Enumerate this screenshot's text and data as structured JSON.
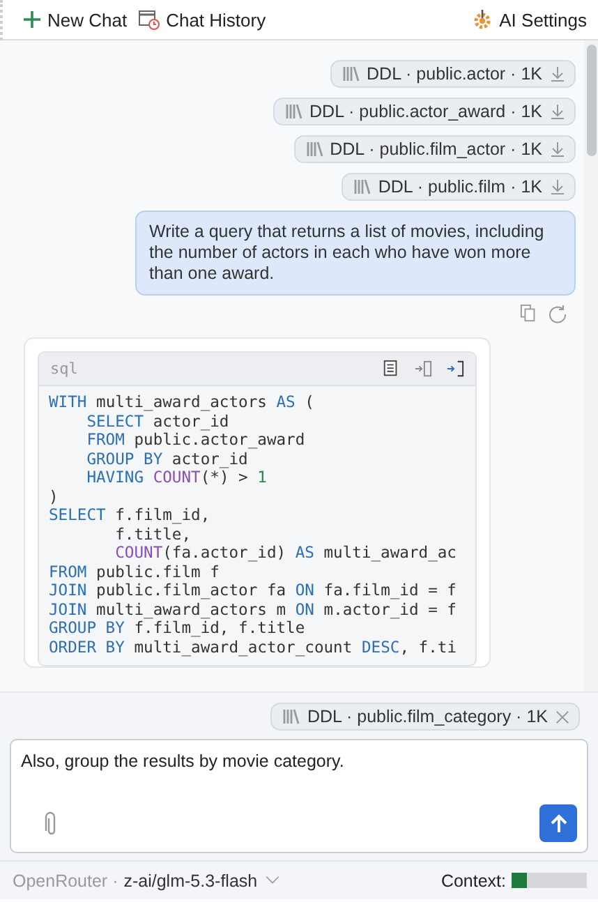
{
  "toolbar": {
    "new_chat": "New Chat",
    "chat_history": "Chat History",
    "ai_settings": "AI Settings"
  },
  "attachments": [
    {
      "label": "DDL · public.actor · 1K"
    },
    {
      "label": "DDL · public.actor_award · 1K"
    },
    {
      "label": "DDL · public.film_actor · 1K"
    },
    {
      "label": "DDL · public.film · 1K"
    }
  ],
  "user_message": "Write a query that returns a list of movies, including the number of actors in each who have won more than one award.",
  "code_block": {
    "language": "sql",
    "lines": [
      [
        {
          "kind": "kw",
          "text": "WITH"
        },
        {
          "kind": "plain",
          "text": " multi_award_actors "
        },
        {
          "kind": "kw",
          "text": "AS"
        },
        {
          "kind": "plain",
          "text": " ("
        }
      ],
      [
        {
          "kind": "kw",
          "text": "    SELECT"
        },
        {
          "kind": "plain",
          "text": " actor_id"
        }
      ],
      [
        {
          "kind": "kw",
          "text": "    FROM"
        },
        {
          "kind": "plain",
          "text": " public.actor_award"
        }
      ],
      [
        {
          "kind": "kw",
          "text": "    GROUP BY"
        },
        {
          "kind": "plain",
          "text": " actor_id"
        }
      ],
      [
        {
          "kind": "kw",
          "text": "    HAVING "
        },
        {
          "kind": "fn",
          "text": "COUNT"
        },
        {
          "kind": "plain",
          "text": "(*) > "
        },
        {
          "kind": "num",
          "text": "1"
        }
      ],
      [
        {
          "kind": "plain",
          "text": ")"
        }
      ],
      [
        {
          "kind": "kw",
          "text": "SELECT"
        },
        {
          "kind": "plain",
          "text": " f.film_id,"
        }
      ],
      [
        {
          "kind": "plain",
          "text": "       f.title,"
        }
      ],
      [
        {
          "kind": "fn",
          "text": "       COUNT"
        },
        {
          "kind": "plain",
          "text": "(fa.actor_id) "
        },
        {
          "kind": "kw",
          "text": "AS"
        },
        {
          "kind": "plain",
          "text": " multi_award_ac"
        }
      ],
      [
        {
          "kind": "kw",
          "text": "FROM"
        },
        {
          "kind": "plain",
          "text": " public.film f"
        }
      ],
      [
        {
          "kind": "kw",
          "text": "JOIN"
        },
        {
          "kind": "plain",
          "text": " public.film_actor fa "
        },
        {
          "kind": "kw",
          "text": "ON"
        },
        {
          "kind": "plain",
          "text": " fa.film_id = f"
        }
      ],
      [
        {
          "kind": "kw",
          "text": "JOIN"
        },
        {
          "kind": "plain",
          "text": " multi_award_actors m "
        },
        {
          "kind": "kw",
          "text": "ON"
        },
        {
          "kind": "plain",
          "text": " m.actor_id = f"
        }
      ],
      [
        {
          "kind": "kw",
          "text": "GROUP BY"
        },
        {
          "kind": "plain",
          "text": " f.film_id, f.title"
        }
      ],
      [
        {
          "kind": "kw",
          "text": "ORDER BY"
        },
        {
          "kind": "plain",
          "text": " multi_award_actor_count "
        },
        {
          "kind": "kw",
          "text": "DESC"
        },
        {
          "kind": "plain",
          "text": ", f.ti"
        }
      ]
    ]
  },
  "pending_attachment": {
    "label": "DDL · public.film_category · 1K"
  },
  "input": {
    "value": "Also, group the results by movie category."
  },
  "status_bar": {
    "provider": "OpenRouter ·",
    "model": "z-ai/glm-5.3-flash",
    "context_label": "Context:",
    "context": {
      "level": 0.2
    }
  }
}
